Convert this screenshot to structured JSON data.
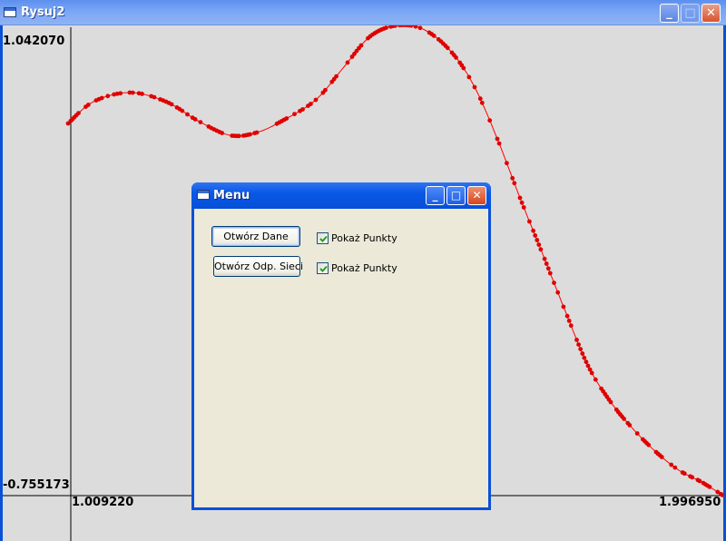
{
  "window": {
    "title": "Rysuj2",
    "minimize_glyph": "_",
    "maximize_glyph": "□",
    "close_glyph": "✕"
  },
  "plot": {
    "y_max_label": "1.042070",
    "y_min_label": "-0.755173",
    "x_min_label": "1.009220",
    "x_max_label": "1.996950",
    "curve_color": "#ff0000",
    "point_color": "#e00000"
  },
  "dialog": {
    "title": "Menu",
    "minimize_glyph": "_",
    "maximize_glyph": "□",
    "close_glyph": "✕",
    "open_data_button": "Otwórz Dane",
    "open_net_button": "Otwórz Odp. Sieci",
    "show_points_1": "Pokaż Punkty",
    "show_points_2": "Pokaż Punkty",
    "show_points_1_checked": true,
    "show_points_2_checked": true
  }
}
